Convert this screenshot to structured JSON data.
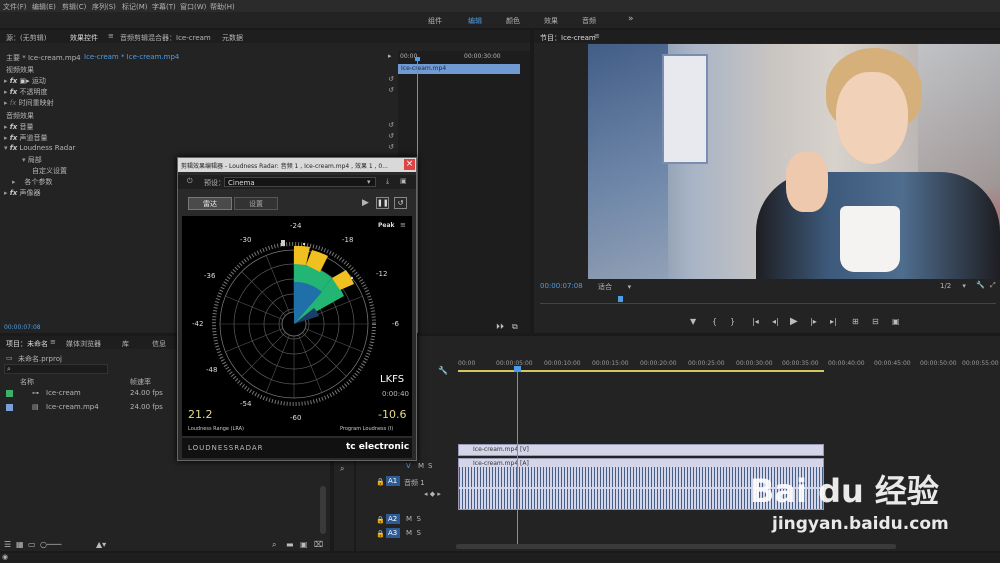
{
  "menubar": {
    "items": [
      "文件(F)",
      "编辑(E)",
      "剪辑(C)",
      "序列(S)",
      "标记(M)",
      "字幕(T)",
      "窗口(W)",
      "帮助(H)"
    ]
  },
  "workspaces": {
    "items": [
      "组件",
      "编辑",
      "颜色",
      "效果",
      "音频"
    ],
    "active": "编辑",
    "more": "»"
  },
  "source_panel": {
    "tabs": [
      "源：(无剪辑)",
      "效果控件",
      "音频剪辑混合器：Ice-cream",
      "元数据"
    ],
    "active_tab": "效果控件",
    "master": "主要 * Ice-cream.mp4",
    "clip": "Ice-cream * Ice-cream.mp4",
    "timecode_start": "00:00",
    "timecode_mid": "00:00:30:00",
    "clip_bar": "Ice-cream.mp4",
    "video_effects_header": "视频效果",
    "video_effects": [
      "运动",
      "不透明度",
      "时间重映射"
    ],
    "audio_effects_header": "音频效果",
    "audio_effects": [
      "音量",
      "声道音量",
      "Loudness Radar"
    ],
    "loudness_children": [
      "局部",
      "自定义设置",
      "各个参数"
    ],
    "extra": "声像器",
    "footer_timecode": "00:00:07:08"
  },
  "program_panel": {
    "title": "节目：Ice-cream",
    "timecode": "00:00:07:08",
    "fit": "适合",
    "ratio": "1/2"
  },
  "project_panel": {
    "tabs": [
      "项目：未命名",
      "媒体浏览器",
      "库",
      "信息"
    ],
    "project_file": "未命名.prproj",
    "col_name": "名称",
    "col_fps": "帧速率",
    "items": [
      {
        "name": "Ice-cream",
        "fps": "24.00 fps",
        "color": "#3fb06a"
      },
      {
        "name": "Ice-cream.mp4",
        "fps": "24.00 fps",
        "color": "#7a9fd6"
      }
    ]
  },
  "timeline": {
    "ruler": [
      "00:00",
      "00:00:05:00",
      "00:00:10:00",
      "00:00:15:00",
      "00:00:20:00",
      "00:00:25:00",
      "00:00:30:00",
      "00:00:35:00",
      "00:00:40:00",
      "00:00:45:00",
      "00:00:50:00",
      "00:00:55:00",
      "00:01:00:00",
      "00:01:05:00"
    ],
    "video_clip": "Ice-cream.mp4 [V]",
    "audio_clip": "Ice-cream.mp4 [A]",
    "audio_track_name": "音频 1",
    "tracks": [
      "A1",
      "A2",
      "A3"
    ]
  },
  "dialog": {
    "title": "剪辑效果编辑器 - Loudness Radar: 音频 1 , Ice-cream.mp4 , 效果 1 , 0...",
    "close": "×",
    "preset_label": "预设：",
    "preset_value": "Cinema",
    "tabs": [
      "雷达",
      "设置"
    ],
    "active_tab": "雷达",
    "peak": "Peak",
    "ring_labels": [
      "-24",
      "-18",
      "-12",
      "-6",
      "-60",
      "-54",
      "-48",
      "-42",
      "-36",
      "-30"
    ],
    "unit": "LKFS",
    "time": "0:00:40",
    "lra_value": "21.2",
    "lra_label": "Loudness Range (LRA)",
    "program_value": "-10.6",
    "program_label": "Program Loudness (I)",
    "brand_left": "LOUDNESSRADAR",
    "brand_right": "tc electronic"
  },
  "watermark": {
    "text": "Bai du 经验",
    "url": "jingyan.baidu.com"
  },
  "colors": {
    "accent": "#4b9de8",
    "radar_green": "#22b573",
    "radar_yellow": "#f0c020",
    "radar_blue": "#1f6fa8"
  }
}
